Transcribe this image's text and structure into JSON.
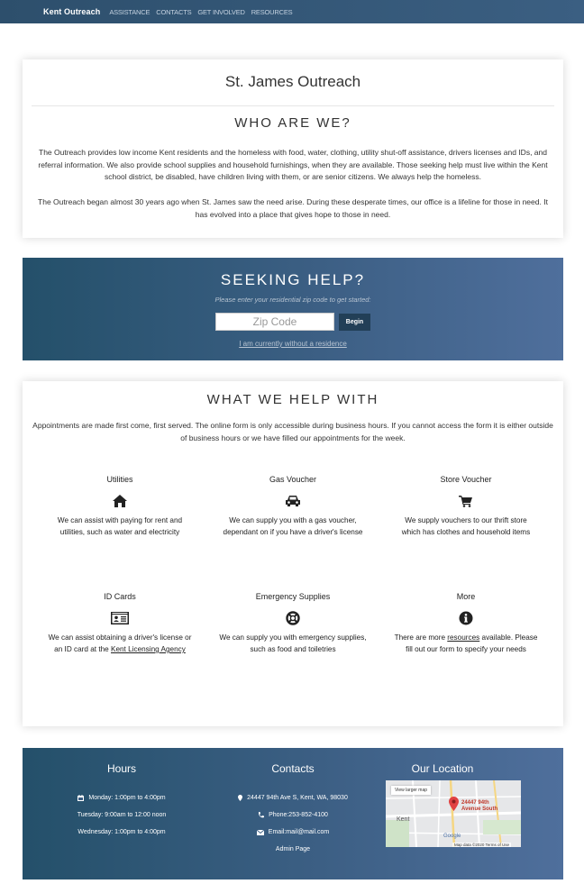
{
  "nav": {
    "brand": "Kent Outreach",
    "links": [
      "ASSISTANCE",
      "CONTACTS",
      "GET INVOLVED",
      "RESOURCES"
    ]
  },
  "about": {
    "org_title": "St. James Outreach",
    "heading": "WHO ARE WE?",
    "paragraph_1": "The Outreach provides low income Kent residents and the homeless with food, water, clothing, utility shut-off assistance, drivers licenses and IDs, and referral information. We also provide school supplies and household furnishings, when they are available. Those seeking help must live within the Kent school district, be disabled, have children living with them, or are senior citizens. We always help the homeless.",
    "paragraph_2": "The Outreach began almost 30 years ago when St. James saw the need arise. During these desperate times, our office is a lifeline for those in need. It has evolved into a place that gives hope to those in need."
  },
  "seeking_help": {
    "heading": "SEEKING HELP?",
    "subtitle": "Please enter your residential zip code to get started:",
    "zip_placeholder": "Zip Code",
    "begin_label": "Begin",
    "no_residence_link": "I am currently without a residence"
  },
  "help": {
    "heading": "WHAT WE HELP WITH",
    "intro": "Appointments are made first come, first served. The online form is only accessible during business hours. If you cannot access the form it is either outside of business hours or we have filled our appointments for the week.",
    "services": [
      {
        "title": "Utilities",
        "icon": "home-icon",
        "desc_1": "We can assist with paying for rent and",
        "desc_2": "utilities, such as water and electricity"
      },
      {
        "title": "Gas Voucher",
        "icon": "car-icon",
        "desc_1": "We can supply you with a gas voucher,",
        "desc_2": "dependant on if you have a driver's license"
      },
      {
        "title": "Store Voucher",
        "icon": "shopping-cart-icon",
        "desc_1": "We supply vouchers to our thrift store",
        "desc_2": "which has clothes and household items"
      },
      {
        "title": "ID Cards",
        "icon": "id-card-icon",
        "desc_1": "We can assist obtaining a driver's license or",
        "desc_2_prefix": "an ID card at the ",
        "desc_2_link": "Kent Licensing Agency"
      },
      {
        "title": "Emergency Supplies",
        "icon": "life-ring-icon",
        "desc_1": "We can supply you with emergency supplies,",
        "desc_2": "such as food and toiletries"
      },
      {
        "title": "More",
        "icon": "info-circle-icon",
        "desc_1_prefix": "There are more ",
        "desc_1_link": "resources",
        "desc_1_suffix": " available. Please",
        "desc_2": "fill out our form to specify your needs"
      }
    ]
  },
  "footer": {
    "hours_title": "Hours",
    "hours": [
      "Monday: 1:00pm to 4:00pm",
      "Tuesday: 9:00am to 12:00 noon",
      "Wednesday: 1:00pm to 4:00pm"
    ],
    "contacts_title": "Contacts",
    "address": "24447 94th Ave S, Kent, WA, 98030",
    "phone": "Phone:253-852-4100",
    "email": "Email:mail@mail.com",
    "admin": "Admin Page",
    "location_title": "Our Location",
    "map": {
      "view_larger": "View larger map",
      "pin_label_1": "24447 94th",
      "pin_label_2": "Avenue South",
      "city_label": "Kent",
      "provider": "Google",
      "attribution": "Map data ©2020   Terms of Use"
    }
  },
  "colors": {
    "navbar": "#2d4f6c",
    "banner_start": "#24506a",
    "banner_end": "#4f6f9c",
    "button_dark": "#223f57"
  }
}
